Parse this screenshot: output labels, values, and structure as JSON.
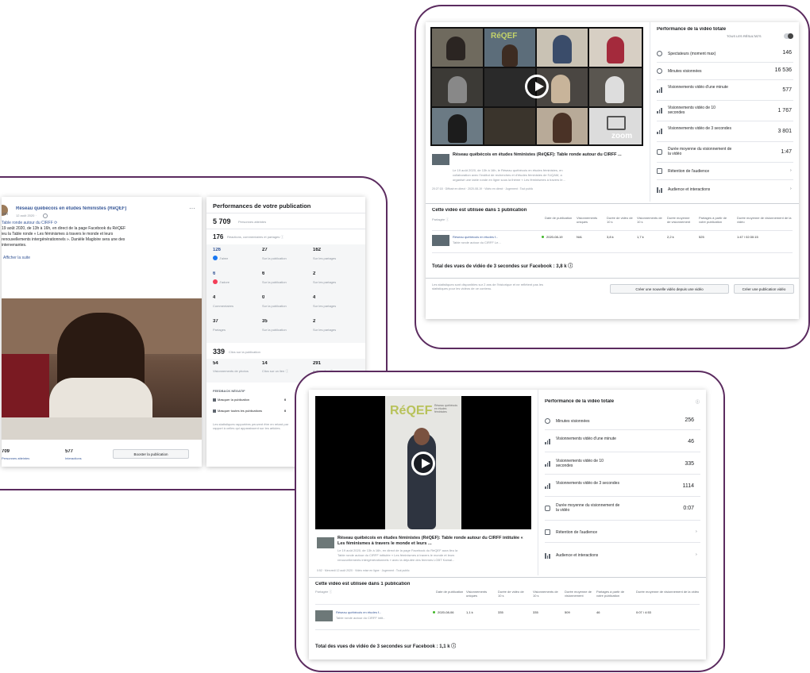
{
  "post_panel": {
    "page_name": "Réseau québécois en études féministes (RéQEF)",
    "page_name_prefix": "am",
    "post_date": "12 août 2020 · ",
    "link_line": "Table ronde autour du CIRFF ⟳",
    "body_text": [
      "19 août 2020, de 13h à 16h, en direct de la page Facebook du RéQEF",
      "ieu la Table ronde « Les féminismes à travers le monde et leurs",
      "renouvellements intergénérationnels ». Danièle Magloire sera une des",
      "intervenantes."
    ],
    "see_more": "Afficher la suite",
    "bottom_stats": [
      {
        "value": "709",
        "label": "Personnes atteintes"
      },
      {
        "value": "577",
        "label": "Interactions"
      }
    ],
    "boost_button": "Booster la publication"
  },
  "performance": {
    "title": "Performances de votre publication",
    "reach": {
      "value": "5 709",
      "label": "Personnes atteintes"
    },
    "reactions": {
      "value": "176",
      "label": "Réactions, commentaires et partages ⓘ"
    },
    "grid": [
      [
        {
          "value": "126",
          "label": "J'aime",
          "icon": "like-icon"
        },
        {
          "value": "27",
          "label": "Sur la publication"
        },
        {
          "value": "162",
          "label": "Sur les partages"
        }
      ],
      [
        {
          "value": "6",
          "label": "J'adore",
          "icon": "love-icon"
        },
        {
          "value": "6",
          "label": "Sur la publication"
        },
        {
          "value": "2",
          "label": "Sur les partages"
        }
      ],
      [
        {
          "value": "4",
          "label": "Commentaires"
        },
        {
          "value": "0",
          "label": "Sur la publication"
        },
        {
          "value": "4",
          "label": "Sur les partages"
        }
      ],
      [
        {
          "value": "37",
          "label": "Partages"
        },
        {
          "value": "35",
          "label": "Sur la publication"
        },
        {
          "value": "2",
          "label": "Sur les partages"
        }
      ]
    ],
    "clicks": {
      "value": "339",
      "label": "Clics sur la publication"
    },
    "click_grid": [
      {
        "value": "54",
        "label": "Visionnements de photos"
      },
      {
        "value": "14",
        "label": "Clics sur un lien ⓘ"
      },
      {
        "value": "291",
        "label": "Autres clics ⓘ"
      }
    ],
    "negative_title": "FEEDBACK NÉGATIF",
    "negative_rows": [
      {
        "label": "Masquer la publication",
        "value": "0"
      },
      {
        "label": "Masquer toutes les publications",
        "value": "0"
      }
    ],
    "footnote": "Les statistiques rapportées peuvent être en retard par rapport à celles qui apparaissent sur les articles."
  },
  "video_top": {
    "header_title": "Performance de la vidéo totale",
    "toggle_label": "TOUS LES RÉSULTATS",
    "metrics": [
      {
        "label": "Spectateurs (moment max)",
        "value": "146",
        "icon": "viewers-icon"
      },
      {
        "label": "Minutes visionnées",
        "value": "16 536",
        "icon": "clock-icon"
      },
      {
        "label": "Visionnements vidéo d'une minute",
        "value": "577",
        "icon": "bars-icon"
      },
      {
        "label": "Visionnements vidéo de 10 secondes",
        "value": "1 767",
        "icon": "bars-icon"
      },
      {
        "label": "Visionnements vidéo de 3 secondes",
        "value": "3 801",
        "icon": "bars-icon"
      },
      {
        "label": "Durée moyenne du visionnement de la vidéo",
        "value": "1:47",
        "icon": "timer-icon"
      },
      {
        "label": "Rétention de l'audience",
        "value": "",
        "icon": "retention-icon"
      },
      {
        "label": "Audience et interactions",
        "value": "",
        "icon": "audience-icon"
      }
    ],
    "post_title": "Réseau québécois en études féministes (RéQEF): Table ronde autour du CIRFF ...",
    "post_text": [
      "Le 19 août 2020, de 13h à 16h, le Réseau québécois en études féministes, en",
      "collaboration avec l'Institut de recherches et d'études féministes de l'UQAM, a",
      "organisé une table ronde en ligne sous la thème « Les féminismes à travers le..."
    ],
    "post_meta": "20:27:18 · Diffusé en direct · 2020-08-19 · Vidéo en direct · Jugement : Tout public",
    "zoom_label": "zoom",
    "usage_title": "Cette vidéo est utilisée dans 1 publication",
    "usage_sub": "Partagée ⓘ",
    "columns": [
      "Date de publication",
      "Visionnements uniques",
      "Durée de vidéo de 10 s",
      "Visionnements de 10 s",
      "Durée moyenne de visionnement",
      "Partages à partir de votre publication",
      "Durée moyenne de visionnement de la vidéo"
    ],
    "row": {
      "title": "Réseau québécois en études f...",
      "subtitle": "Table ronde autour du CIRFF Le...",
      "date": "2020-08-19",
      "cells": [
        "N/A",
        "3,8 k",
        "1,7 k",
        "2,2 k",
        "525",
        "1:47 / 02:30:15"
      ]
    },
    "total": "Total des vues de vidéo de 3 secondes sur Facebook : 3,8 k ⓘ",
    "footer_note": "Les statistiques sont disponibles sur 2 ans de l'historique et ne reflètent pas les statistiques pour les vidéos de ce contenu.",
    "btn_new_video": "Créer une nouvelle vidéo depuis une vidéo",
    "btn_new_post": "Créer une publication vidéo"
  },
  "video_bottom": {
    "header_title": "Performance de la vidéo totale",
    "brand": "RéQEF",
    "brand_sub": "Réseau québécois en études féministes",
    "metrics": [
      {
        "label": "Minutes visionnées",
        "value": "256",
        "icon": "clock-icon"
      },
      {
        "label": "Visionnements vidéo d'une minute",
        "value": "46",
        "icon": "bars-icon"
      },
      {
        "label": "Visionnements vidéo de 10 secondes",
        "value": "335",
        "icon": "bars-icon"
      },
      {
        "label": "Visionnements vidéo de 3 secondes",
        "value": "1114",
        "icon": "bars-icon"
      },
      {
        "label": "Durée moyenne du visionnement de la vidéo",
        "value": "0:07",
        "icon": "timer-icon"
      },
      {
        "label": "Rétention de l'audience",
        "value": "",
        "icon": "retention-icon"
      },
      {
        "label": "Audience et interactions",
        "value": "",
        "icon": "audience-icon"
      }
    ],
    "post_title": "Réseau québécois en études féministes (RéQEF): Table ronde autour du CIRFF intitulée « Les féminismes à travers le monde et leurs ...",
    "post_text": [
      "Le 19 août 2020, de 13h à 16h, en direct de la page Facebook du RéQEF aura lieu la",
      "Table ronde autour du CIRFF intitulée « Les féminismes à travers le monde et leurs",
      "renouvellements intergénérationnels » avec la députée des femmes LGBT Kamal..."
    ],
    "post_meta": "0:52 · Mercredi 12 août 2020 · Vidéo mise en ligne · Jugement : Tout public",
    "usage_title": "Cette vidéo est utilisée dans 1 publication",
    "usage_sub": "Partagée ⓘ",
    "columns": [
      "Date de publication",
      "Visionnements uniques",
      "Durée de vidéo de 10 s",
      "Visionnements de 10 s",
      "Durée moyenne de visionnement",
      "Partages à partir de votre publication",
      "Durée moyenne de visionnement de la vidéo"
    ],
    "row": {
      "title": "Réseau québécois en études f...",
      "subtitle": "Table ronde autour du CIRFF intit...",
      "date": "2020-08-06",
      "cells": [
        "1,1 k",
        "335",
        "335",
        "509",
        "46",
        "0:07 / 4:53"
      ]
    },
    "total": "Total des vues de vidéo de 3 secondes sur Facebook : 1,1 k ⓘ"
  }
}
